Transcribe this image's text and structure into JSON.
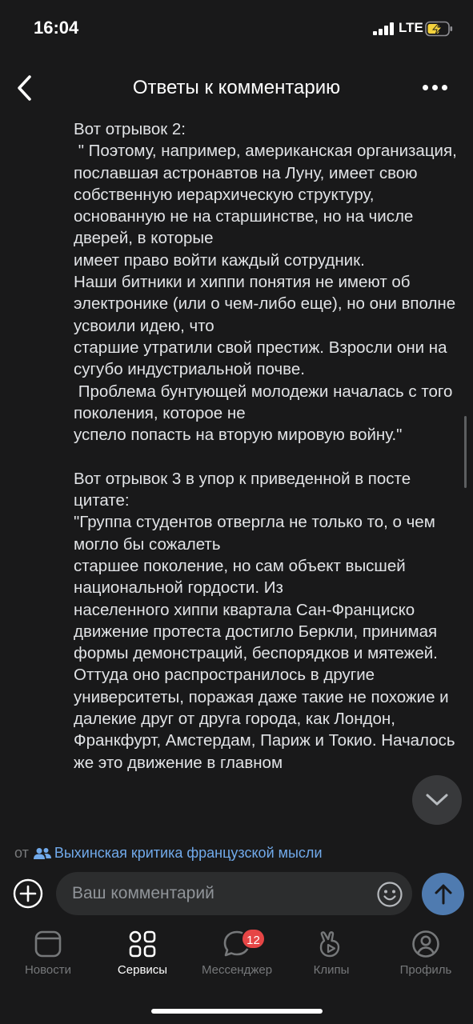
{
  "status": {
    "time": "16:04",
    "network": "LTE"
  },
  "header": {
    "title": "Ответы к комментарию"
  },
  "comment": {
    "text": "Вот отрывок 2:\n \" Поэтому, например, американская организация,\nпославшая астронавтов на Луну, имеет свою собственную иерархическую структуру, основанную не на старшинстве, но на числе дверей, в которые\nимеет право войти каждый сотрудник.\nНаши битники и хиппи понятия не имеют об электронике (или о чем-либо еще), но они вполне усвоили идею, что\nстаршие утратили свой престиж. Взросли они на сугубо индустриальной почве.\n Проблема бунтующей молодежи началась с того поколения, которое не\nуспело попасть на вторую мировую войну.\"\n\nВот отрывок 3 в упор к приведенной в посте цитате:\n\"Группа студентов отвергла не только то, о чем могло бы сожалеть\nстаршее поколение, но сам объект высшей национальной гордости. Из\nнаселенного хиппи квартала Сан-Франциско движение протеста достигло Беркли, принимая формы демонстраций, беспорядков и мятежей. Оттуда оно распространилось в другие университеты, поражая даже такие не похожие и далекие друг от друга города, как Лондон, Франкфурт, Амстердам, Париж и Токио. Началось же это движение в главном"
  },
  "group": {
    "prefix": "от",
    "name": "Выхинская критика французской мысли"
  },
  "composer": {
    "placeholder": "Ваш комментарий"
  },
  "tabs": [
    {
      "label": "Новости",
      "icon": "news-icon",
      "active": false
    },
    {
      "label": "Сервисы",
      "icon": "services-icon",
      "active": true
    },
    {
      "label": "Мессенджер",
      "icon": "messenger-icon",
      "active": false,
      "badge": "12"
    },
    {
      "label": "Клипы",
      "icon": "clips-icon",
      "active": false
    },
    {
      "label": "Профиль",
      "icon": "profile-icon",
      "active": false
    }
  ],
  "colors": {
    "background": "#19191a",
    "link": "#71aaeb",
    "accent_button": "#4f7bb0",
    "badge": "#e64646",
    "battery_fill": "#f4d23d"
  }
}
